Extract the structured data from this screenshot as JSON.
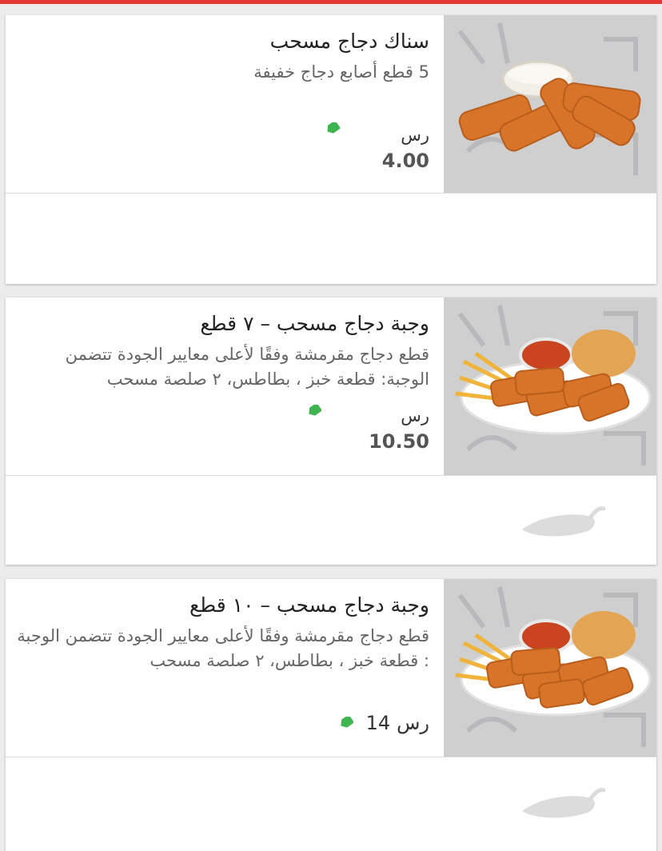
{
  "items": [
    {
      "name": "سناك دجاج مسحب",
      "description": "5 قطع أصابع دجاج خفيفة",
      "currency": "رس",
      "price": "4.00",
      "photo_icon": "chicken-fingers-dip-photo"
    },
    {
      "name": "وجبة دجاج مسحب – ٧ قطع",
      "description": "قطع دجاج مقرمشة وفقًا لأعلى معايير الجودة تتضمن الوجبة: قطعة خبز ، بطاطس، ٢ صلصة مسحب",
      "currency": "رس",
      "price": "10.50",
      "photo_icon": "chicken-meal-plate-photo",
      "spicy_icon": "chili-pepper-icon"
    },
    {
      "name": "وجبة دجاج مسحب – ١٠ قطع",
      "description": "قطع دجاج مقرمشة وفقًا لأعلى معايير الجودة تتضمن الوجبة : قطعة خبز ، بطاطس، ٢ صلصة مسحب",
      "currency": "رس",
      "price": "14",
      "photo_icon": "chicken-meal-plate-photo",
      "spicy_icon": "chili-pepper-icon"
    }
  ],
  "colors": {
    "accent_bar": "#e23a33",
    "tag_green": "#3fb550",
    "chili_gray": "#dcdcdc"
  }
}
